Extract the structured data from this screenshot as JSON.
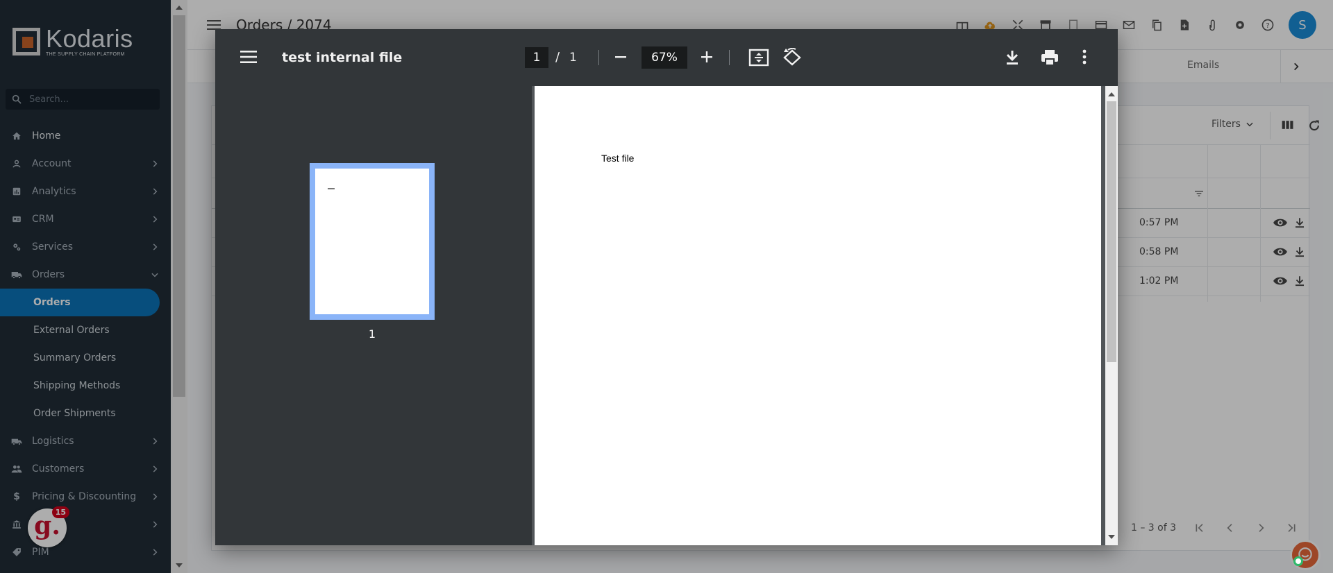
{
  "brand": {
    "name": "Kodaris",
    "tagline": "THE SUPPLY CHAIN PLATFORM"
  },
  "sidebar": {
    "search_placeholder": "Search...",
    "items": [
      {
        "label": "Home",
        "icon": "home-icon"
      },
      {
        "label": "Account",
        "icon": "account-icon"
      },
      {
        "label": "Analytics",
        "icon": "analytics-icon"
      },
      {
        "label": "CRM",
        "icon": "crm-icon"
      },
      {
        "label": "Services",
        "icon": "services-icon"
      },
      {
        "label": "Orders",
        "icon": "truck-icon"
      }
    ],
    "orders_sub": [
      {
        "label": "Orders",
        "active": true
      },
      {
        "label": "External Orders"
      },
      {
        "label": "Summary Orders"
      },
      {
        "label": "Shipping Methods"
      },
      {
        "label": "Order Shipments"
      }
    ],
    "items_after": [
      {
        "label": "Logistics",
        "icon": "logistics-icon"
      },
      {
        "label": "Customers",
        "icon": "customers-icon"
      },
      {
        "label": "Pricing & Discounting",
        "icon": "dollar-icon"
      },
      {
        "label": "",
        "icon": "bank-icon"
      },
      {
        "label": "PIM",
        "icon": "tag-icon"
      }
    ],
    "widget_badge": "15",
    "widget_letter": "g."
  },
  "header": {
    "breadcrumb": "Orders / 2074",
    "avatar_initial": "S"
  },
  "tabs": {
    "emails": "Emails"
  },
  "table": {
    "filters_label": "Filters",
    "rows": [
      {
        "time": "0:57 PM"
      },
      {
        "time": "0:58 PM"
      },
      {
        "time": "1:02 PM"
      }
    ],
    "pagination": "1 – 3 of 3"
  },
  "viewer": {
    "title": "test internal file",
    "current_page": "1",
    "total_pages": "1",
    "slash": "/",
    "zoom": "67%",
    "thumbnail_label": "1",
    "page_text": "Test file"
  },
  "colors": {
    "active_nav": "#0b73b8",
    "sidebar_bg": "#212d37",
    "viewer_toolbar": "#323639",
    "thumb_highlight": "#8ab4f8"
  }
}
